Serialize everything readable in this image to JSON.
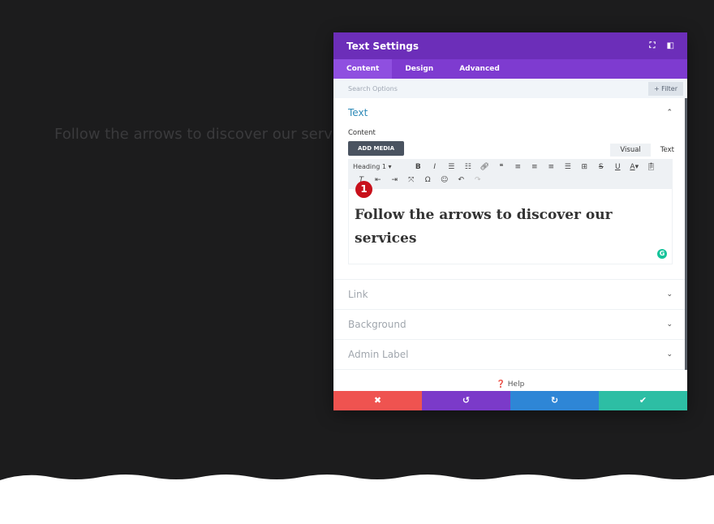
{
  "background": {
    "text": "Follow the arrows to discover our services"
  },
  "modal": {
    "title": "Text Settings",
    "tabs": [
      {
        "label": "Content"
      },
      {
        "label": "Design"
      },
      {
        "label": "Advanced"
      }
    ],
    "search": {
      "placeholder": "Search Options",
      "filter_label": "+ Filter"
    },
    "text_section": {
      "title": "Text",
      "content_label": "Content",
      "add_media": "ADD MEDIA",
      "visual_tab": "Visual",
      "text_tab": "Text",
      "format_select": "Heading 1",
      "editor_content": "Follow the arrows to discover our services",
      "badge": "1"
    },
    "sections": [
      {
        "label": "Link"
      },
      {
        "label": "Background"
      },
      {
        "label": "Admin Label"
      }
    ],
    "help": "Help",
    "colors": {
      "header": "#6c2eb9",
      "tabs": "#7e3bd0",
      "cancel": "#ef5350",
      "undo": "#7b3ac9",
      "redo": "#2e86d6",
      "save": "#2dbea4"
    }
  }
}
